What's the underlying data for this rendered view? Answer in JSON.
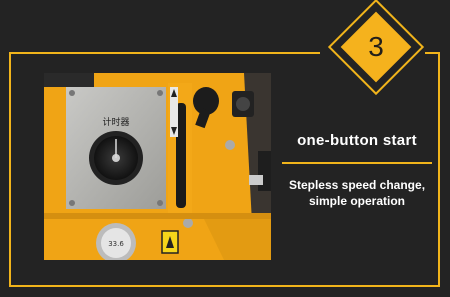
{
  "badge": {
    "number": "3"
  },
  "feature": {
    "title": "one-button start",
    "description": "Stepless speed change, simple operation"
  },
  "photo": {
    "panel_label": "计时器",
    "gauge_label": "33.6"
  },
  "colors": {
    "accent": "#f1b41b",
    "background": "#232323",
    "machine_yellow": "#f0a415"
  }
}
